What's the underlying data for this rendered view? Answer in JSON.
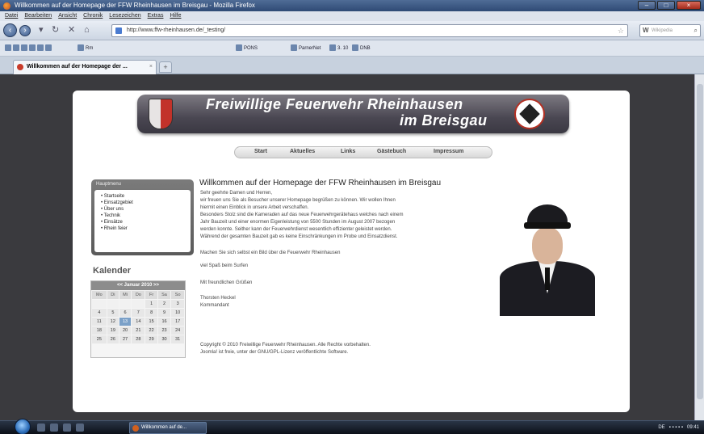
{
  "window": {
    "title": "Willkommen auf der Homepage der FFW Rheinhausen im Breisgau - Mozilla Firefox"
  },
  "menubar": [
    "Datei",
    "Bearbeiten",
    "Ansicht",
    "Chronik",
    "Lesezeichen",
    "Extras",
    "Hilfe"
  ],
  "navbar": {
    "url": "http://www.ffw-rheinhausen.de/_testing/",
    "search_engine_icon": "W",
    "search_placeholder": "Wikipedia"
  },
  "bookmarks": [
    "Rm",
    "PONS",
    "ParnerNet",
    "3. 10",
    "DNB"
  ],
  "tab": {
    "label": "Willkommen auf der Homepage der ...",
    "close": "×",
    "new": "+"
  },
  "banner": {
    "line1": "Freiwillige Feuerwehr Rheinhausen",
    "line2": "im Breisgau"
  },
  "site_menu": [
    "Start",
    "Aktuelles",
    "Links",
    "Gästebuch",
    "Impressum"
  ],
  "sidebar": {
    "header": "Hauptmenu",
    "items": [
      "Startseite",
      "Einsatzgebiet",
      "Über uns",
      "Technik",
      "Einsätze",
      "Rhein feier"
    ]
  },
  "calendar": {
    "title": "Kalender",
    "month": "<< Januar 2010 >>",
    "day_headers": [
      "Mo",
      "Di",
      "Mi",
      "Do",
      "Fr",
      "Sa",
      "So"
    ],
    "weeks": [
      [
        "",
        "",
        "",
        "",
        "1",
        "2",
        "3"
      ],
      [
        "4",
        "5",
        "6",
        "7",
        "8",
        "9",
        "10"
      ],
      [
        "11",
        "12",
        "13",
        "14",
        "15",
        "16",
        "17"
      ],
      [
        "18",
        "19",
        "20",
        "21",
        "22",
        "23",
        "24"
      ],
      [
        "25",
        "26",
        "27",
        "28",
        "29",
        "30",
        "31"
      ]
    ],
    "today": "13"
  },
  "main": {
    "title": "Willkommen auf der Homepage der FFW Rheinhausen im Breisgau",
    "lines": [
      "Sehr geehrte Damen und Herren,",
      "wir freuen uns Sie als Besucher unserer Homepage begrüßen zu können. Wir wollen Ihnen",
      "hiermit einen Einblick in unsere Arbeit verschaffen.",
      "Besonders Stolz sind die Kameraden auf das neue Feuerwehrgerätehaus welches nach einem",
      "Jahr Bauzeit und einer enormen Eigenleistung von 5500 Stunden im August 2007 bezogen",
      "werden konnte. Seither kann der Feuerwehrdienst wesentlich effizienter geleistet werden.",
      "Während der gesamten Bauzeit gab es keine Einschränkungen im Probe und Einsatzdienst."
    ],
    "line_bild": "Machen Sie sich selbst ein Bild über die Feuerwehr Rheinhausen",
    "line_spass": "viel Spaß beim Surfen",
    "greeting": "Mit freundlichen Grüßen",
    "name": "Thorsten Heckel",
    "role": "Kommandant",
    "copyright": "Copyright © 2010 Freiwillige Feuerwehr Rheinhausen. Alle Rechte vorbehalten.",
    "license": "Joomla! ist freie, unter der GNU/GPL-Lizenz veröffentlichte Software."
  },
  "taskbar": {
    "task_label": "Willkommen auf de...",
    "tray_text": "DE",
    "clock": "09:41"
  }
}
